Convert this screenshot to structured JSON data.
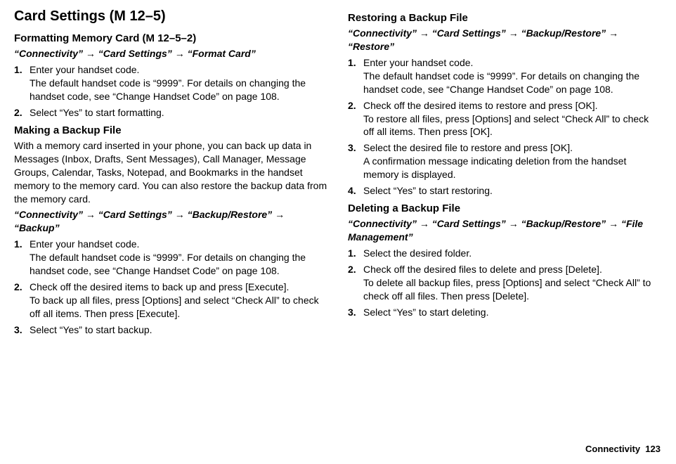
{
  "left": {
    "title": "Card Settings (M 12–5)",
    "format": {
      "heading_prefix": "Formatting Memory Card",
      "heading_code": "(M 12–5–2)",
      "path": "“Connectivity” → “Card Settings” → “Format Card”",
      "steps": [
        {
          "num": "1.",
          "main": "Enter your handset code.",
          "sub": "The default handset code is “9999”. For details on changing the handset code, see “Change Handset Code” on page 108."
        },
        {
          "num": "2.",
          "main": "Select “Yes” to start formatting."
        }
      ]
    },
    "backup": {
      "heading": "Making a Backup File",
      "intro": "With a memory card inserted in your phone, you can back up data in Messages (Inbox, Drafts, Sent Messages), Call Manager, Message Groups, Calendar, Tasks, Notepad, and Bookmarks in the handset memory to the memory card. You can also restore the backup data from the memory card.",
      "path": "“Connectivity” → “Card Settings” → “Backup/Restore” → “Backup”",
      "steps": [
        {
          "num": "1.",
          "main": "Enter your handset code.",
          "sub": "The default handset code is “9999”. For details on changing the handset code, see “Change Handset Code” on page 108."
        },
        {
          "num": "2.",
          "main": "Check off the desired items to back up and press [Execute].",
          "sub": "To back up all files, press [Options] and select “Check All” to check off all items. Then press [Execute]."
        },
        {
          "num": "3.",
          "main": "Select “Yes” to start backup."
        }
      ]
    }
  },
  "right": {
    "restore": {
      "heading": "Restoring a Backup File",
      "path": "“Connectivity” → “Card Settings” → “Backup/Restore” → “Restore”",
      "steps": [
        {
          "num": "1.",
          "main": "Enter your handset code.",
          "sub": "The default handset code is “9999”. For details on changing the handset code, see “Change Handset Code” on page 108."
        },
        {
          "num": "2.",
          "main": "Check off the desired items to restore and press [OK].",
          "sub": "To restore all files, press [Options] and select “Check All” to check off all items. Then press [OK]."
        },
        {
          "num": "3.",
          "main": "Select the desired file to restore and press [OK].",
          "sub": "A confirmation message indicating deletion from the handset memory is displayed."
        },
        {
          "num": "4.",
          "main": "Select “Yes” to start restoring."
        }
      ]
    },
    "delete": {
      "heading": "Deleting a Backup File",
      "path": "“Connectivity” → “Card Settings” → “Backup/Restore” → “File Management”",
      "steps": [
        {
          "num": "1.",
          "main": "Select the desired folder."
        },
        {
          "num": "2.",
          "main": "Check off the desired files to delete and press [Delete].",
          "sub": "To delete all backup files, press [Options] and select “Check All” to check off all files. Then press [Delete]."
        },
        {
          "num": "3.",
          "main": "Select “Yes” to start deleting."
        }
      ]
    }
  },
  "footer": {
    "section": "Connectivity",
    "page": "123"
  }
}
